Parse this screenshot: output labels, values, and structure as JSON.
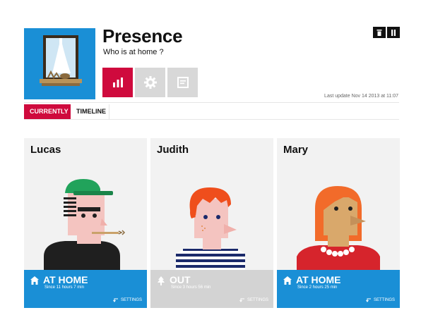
{
  "app": {
    "title": "Presence",
    "subtitle": "Who is at home ?",
    "last_update": "Last update Nov 14 2013 at 11:07"
  },
  "toolbar": {
    "icons": [
      "stats-icon",
      "gear-icon",
      "notes-icon"
    ],
    "window_controls": [
      "delete-icon",
      "pause-icon"
    ]
  },
  "tabs": [
    {
      "label": "CURRENTLY",
      "active": true
    },
    {
      "label": "TIMELINE",
      "active": false
    }
  ],
  "people": [
    {
      "name": "Lucas",
      "status": "AT HOME",
      "since": "Since 11 hours 7 min",
      "settings": "SETTINGS",
      "status_icon": "house-icon"
    },
    {
      "name": "Judith",
      "status": "OUT",
      "since": "Since 3 hours 56 min",
      "settings": "SETTINGS",
      "status_icon": "tree-icon"
    },
    {
      "name": "Mary",
      "status": "AT HOME",
      "since": "Since 2 hours 25 min",
      "settings": "SETTINGS",
      "status_icon": "house-icon"
    }
  ],
  "colors": {
    "accent": "#cf0a3d",
    "home_blue": "#1a8fd6",
    "out_grey": "#d3d3d3",
    "card_bg": "#f2f2f2"
  }
}
